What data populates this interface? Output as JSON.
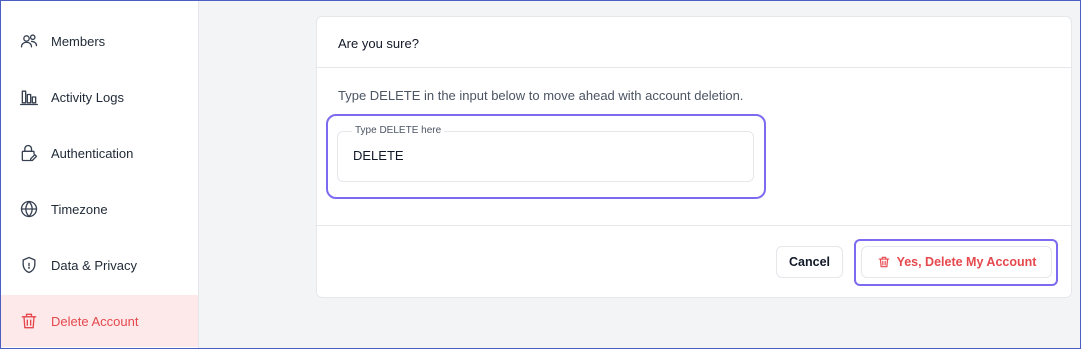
{
  "sidebar": {
    "items": [
      {
        "label": "Members",
        "icon": "members-icon"
      },
      {
        "label": "Activity Logs",
        "icon": "bar-chart-icon"
      },
      {
        "label": "Authentication",
        "icon": "lock-edit-icon"
      },
      {
        "label": "Timezone",
        "icon": "globe-icon"
      },
      {
        "label": "Data & Privacy",
        "icon": "shield-icon"
      },
      {
        "label": "Delete Account",
        "icon": "trash-icon",
        "active": true
      }
    ]
  },
  "dialog": {
    "title": "Are you sure?",
    "description": "Type DELETE in the input below to move ahead with account deletion.",
    "input_label": "Type DELETE here",
    "input_value": "DELETE",
    "cancel_label": "Cancel",
    "confirm_label": "Yes, Delete My Account"
  },
  "colors": {
    "accent_focus": "#7c6bf0",
    "danger": "#e5484d",
    "active_bg": "#fde8ea"
  }
}
